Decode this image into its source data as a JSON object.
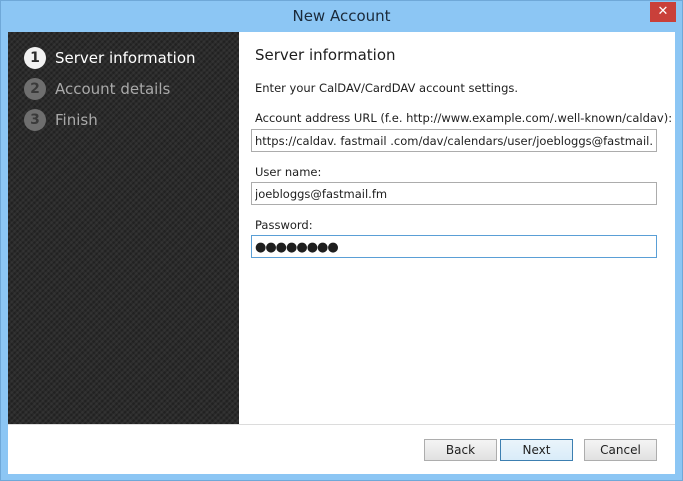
{
  "window": {
    "title": "New Account",
    "close_glyph": "✕"
  },
  "sidebar": {
    "steps": [
      {
        "number": "1",
        "label": "Server information"
      },
      {
        "number": "2",
        "label": "Account details"
      },
      {
        "number": "3",
        "label": "Finish"
      }
    ]
  },
  "content": {
    "section_title": "Server information",
    "intro": "Enter your CalDAV/CardDAV account settings.",
    "url_label": "Account address URL (f.e. http://www.example.com/.well-known/caldav):",
    "url_value": "https://caldav. fastmail .com/dav/calendars/user/joebloggs@fastmail.fm",
    "username_label": "User name:",
    "username_value": "joebloggs@fastmail.fm",
    "password_label": "Password:",
    "password_masked": "●●●●●●●●"
  },
  "footer": {
    "back_label": "Back",
    "next_label": "Next",
    "cancel_label": "Cancel"
  },
  "icons": {
    "close": "close-icon"
  }
}
